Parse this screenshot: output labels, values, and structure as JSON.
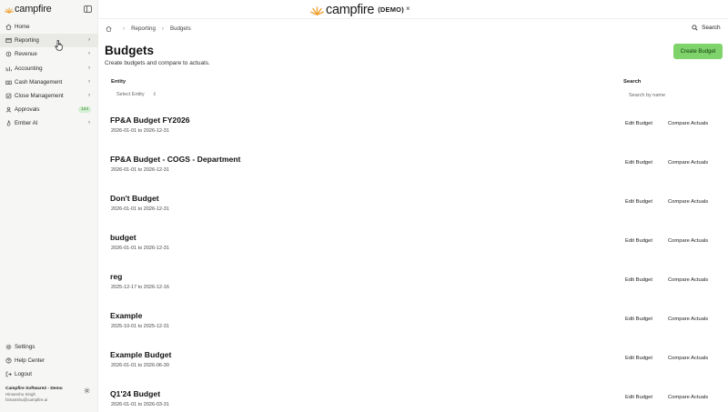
{
  "sidebar": {
    "logo_text": "campfire",
    "items": [
      {
        "label": "Home",
        "icon": "home-icon"
      },
      {
        "label": "Reporting",
        "icon": "reporting-icon"
      },
      {
        "label": "Revenue",
        "icon": "revenue-icon"
      },
      {
        "label": "Accounting",
        "icon": "accounting-icon"
      },
      {
        "label": "Cash Management",
        "icon": "cash-icon"
      },
      {
        "label": "Close Management",
        "icon": "close-icon"
      },
      {
        "label": "Approvals",
        "icon": "approvals-icon",
        "badge": "124"
      },
      {
        "label": "Ember AI",
        "icon": "ember-icon"
      }
    ],
    "bottom_items": [
      {
        "label": "Settings",
        "icon": "gear-icon"
      },
      {
        "label": "Help Center",
        "icon": "help-icon"
      },
      {
        "label": "Logout",
        "icon": "logout-icon"
      }
    ],
    "account": {
      "org": "Campfire Software2 - Demo",
      "user": "Himanshu Singh",
      "email": "himanshu@campfire.ai"
    }
  },
  "banner": {
    "brand": "campfire",
    "tag": "(DEMO)",
    "close": "×"
  },
  "breadcrumb": {
    "items": [
      "Reporting",
      "Budgets"
    ]
  },
  "header": {
    "search_label": "Search",
    "title": "Budgets",
    "subtitle": "Create budgets and compare to actuals.",
    "create_label": "Create Budget"
  },
  "filters": {
    "entity_label": "Entity",
    "entity_value": "Select Entity",
    "search_label": "Search",
    "search_placeholder": "Search by name"
  },
  "actions": {
    "edit": "Edit Budget",
    "compare": "Compare Actuals"
  },
  "budgets": [
    {
      "name": "FP&A Budget FY2026",
      "dates": "2026-01-01 to 2026-12-31"
    },
    {
      "name": "FP&A Budget - COGS - Department",
      "dates": "2026-01-01 to 2026-12-31"
    },
    {
      "name": "Don't Budget",
      "dates": "2026-01-01 to 2026-12-31"
    },
    {
      "name": "budget",
      "dates": "2026-01-01 to 2026-12-31"
    },
    {
      "name": "reg",
      "dates": "2025-12-17 to 2026-12-16"
    },
    {
      "name": "Example",
      "dates": "2025-10-01 to 2025-12-31"
    },
    {
      "name": "Example Budget",
      "dates": "2026-01-01 to 2026-06-30"
    },
    {
      "name": "Q1'24 Budget",
      "dates": "2026-01-01 to 2026-03-31"
    }
  ],
  "colors": {
    "accent": "#7ed36b",
    "brand_orange": "#f0a030",
    "badge_bg": "#d4f0d2",
    "badge_text": "#2f7a2b"
  }
}
